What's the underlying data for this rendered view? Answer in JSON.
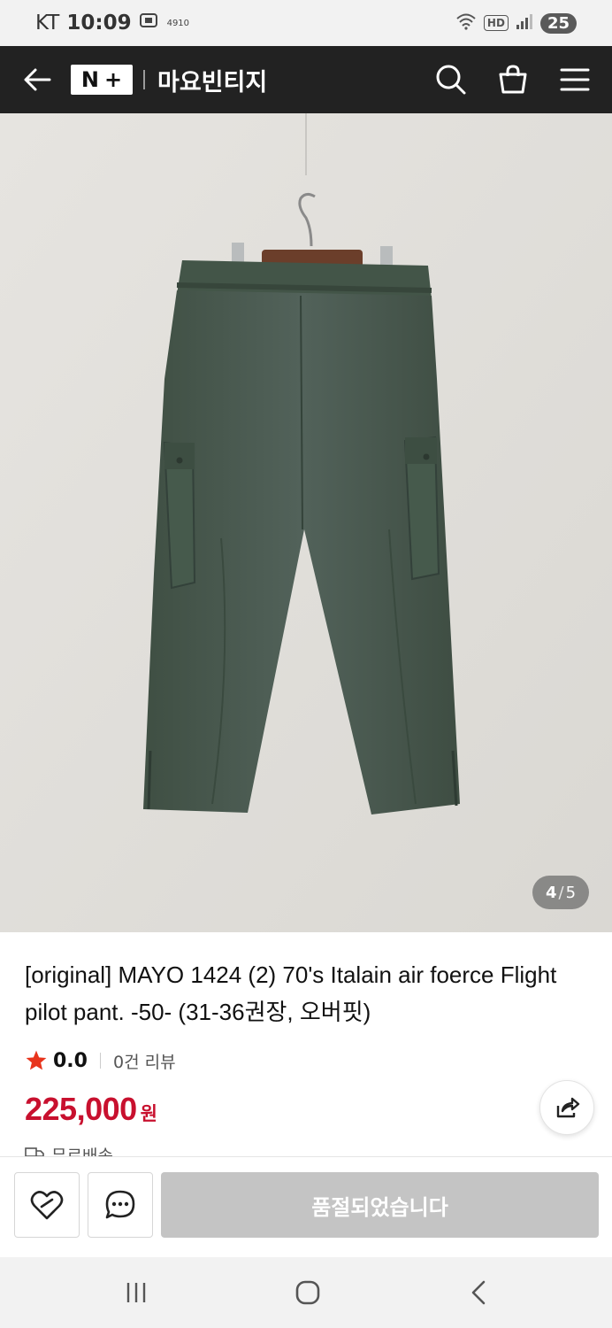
{
  "status_bar": {
    "carrier": "KT",
    "time": "10:09",
    "small_label": "4910",
    "network": "HD",
    "battery": "25"
  },
  "header": {
    "logo_left": "N",
    "logo_right": "+",
    "store_name": "마요빈티지",
    "icons": [
      "back-arrow-icon",
      "search-icon",
      "cart-icon",
      "menu-icon"
    ]
  },
  "gallery": {
    "current": "4",
    "separator": "/",
    "total": "5"
  },
  "product": {
    "title": "[original] MAYO 1424 (2) 70's Italain air foerce Flight pilot pant. -50- (31-36권장, 오버핏)",
    "rating": "0.0",
    "reviews": "0건 리뷰",
    "price": "225,000",
    "currency": "원",
    "shipping_partial": "무료배송"
  },
  "actions": {
    "soldout_label": "품절되었습니다"
  },
  "colors": {
    "header_bg": "#222222",
    "price_red": "#c8102e",
    "star": "#e8341c",
    "soldout_bg": "#c4c4c4",
    "pants_green": "#4a5a4d"
  }
}
